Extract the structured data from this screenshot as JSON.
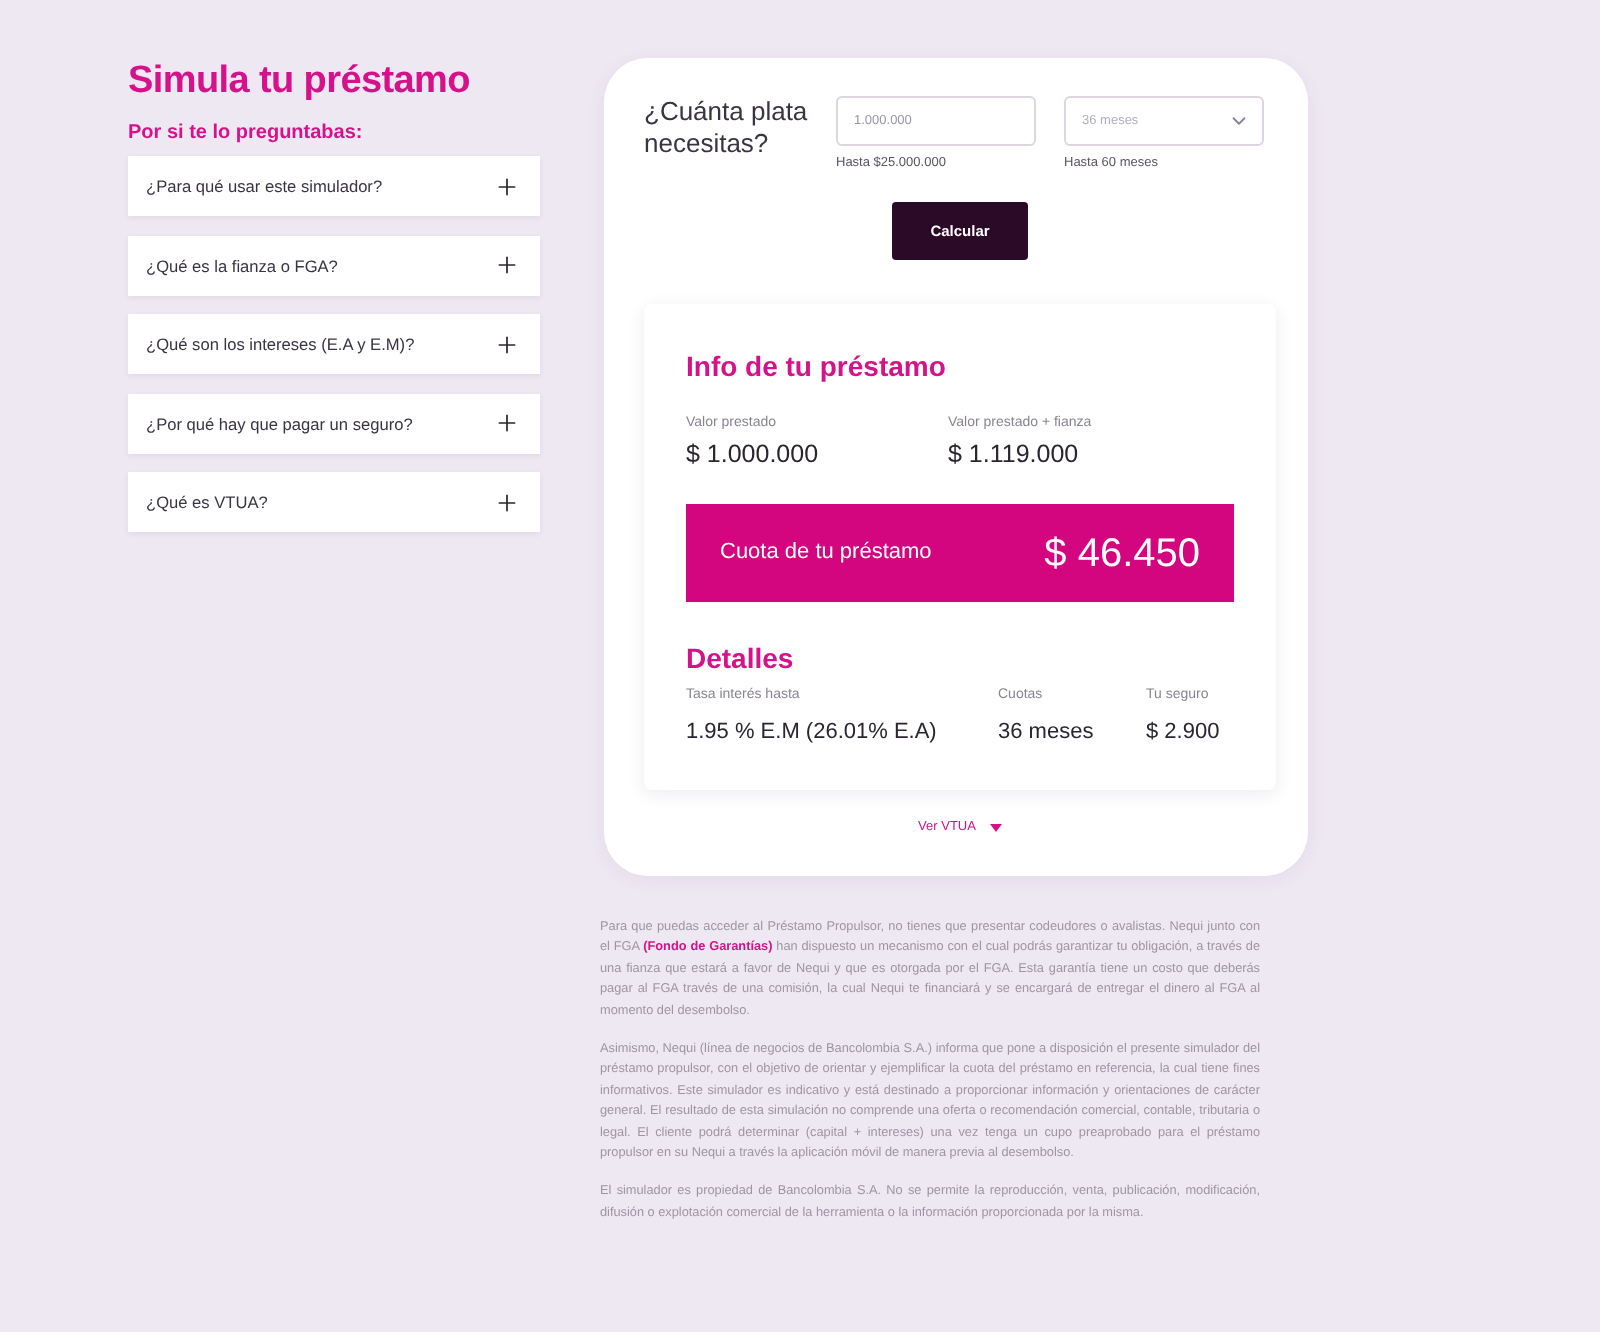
{
  "header": {
    "title": "Simula tu préstamo",
    "subtitle": "Por si te lo preguntabas:"
  },
  "faq": [
    {
      "question": "¿Para qué usar este simulador?",
      "expanded": false
    },
    {
      "question": "¿Qué es la fianza o FGA?",
      "expanded": false
    },
    {
      "question": "¿Qué son los intereses (E.A y E.M)?",
      "expanded": false
    },
    {
      "question": "¿Por qué hay que pagar un seguro?",
      "expanded": false
    },
    {
      "question": "¿Qué es VTUA?",
      "expanded": false
    }
  ],
  "simulator": {
    "question": "¿Cuánta plata necesitas?",
    "amount_field": {
      "value": "1.000.000",
      "hint": "Hasta $25.000.000"
    },
    "term_select": {
      "value": "36 meses",
      "hint": "Hasta 60 meses"
    },
    "button": "Calcular"
  },
  "loan_info": {
    "title": "Info de tu préstamo",
    "amounts": [
      {
        "label": "Valor prestado",
        "value": "$ 1.000.000"
      },
      {
        "label": "Valor prestado + fianza",
        "value": "$ 1.119.000"
      }
    ],
    "installment": {
      "label": "Cuota de tu préstamo",
      "value": "$ 46.450"
    },
    "details_title": "Detalles",
    "details": [
      {
        "label": "Tasa interés hasta",
        "value": "1.95 % E.M (26.01% E.A)"
      },
      {
        "label": "Cuotas",
        "value": "36 meses"
      },
      {
        "label": "Tu seguro",
        "value": "$ 2.900"
      }
    ]
  },
  "vtua_link": {
    "label": "Ver VTUA",
    "expanded": false
  },
  "legal": [
    "Para que puedas acceder al Préstamo Propulsor, no tienes que presentar codeudores o avalistas. Nequi junto con el FGA **(Fondo de Garantías)** han dispuesto un mecanismo con el cual podrás garantizar tu obligación, a través de una fianza que estará a favor de Nequi y que es otorgada por el FGA. Esta garantía tiene un costo que deberás pagar al FGA través de una comisión, la cual Nequi te financiará y se encargará de entregar el dinero al FGA al momento del desembolso.",
    "Asimismo, Nequi (línea de negocios de Bancolombia S.A.) informa que pone a disposición el presente simulador del préstamo propulsor, con el objetivo de orientar y ejemplificar la cuota del préstamo en referencia, la cual tiene fines informativos. Este simulador es indicativo y está destinado a proporcionar información y orientaciones de carácter general. El resultado de esta simulación no comprende una oferta o recomendación comercial, contable, tributaria o legal. El cliente podrá determinar (capital + intereses) una vez tenga un cupo preaprobado para el préstamo propulsor en su Nequi a través la aplicación móvil de manera previa al desembolso.",
    "El simulador es propiedad de Bancolombia S.A. No se permite la reproducción, venta, publicación, modificación, difusión o explotación comercial de la herramienta o la información proporcionada por la misma."
  ]
}
